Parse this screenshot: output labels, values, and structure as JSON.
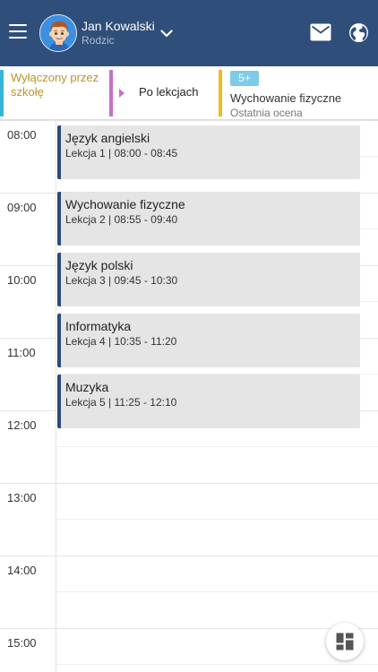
{
  "header": {
    "user_name": "Jan Kowalski",
    "user_role": "Rodzic",
    "menu_icon": "hamburger-menu-icon",
    "dropdown_icon": "chevron-down-icon",
    "mail_icon": "mail-icon",
    "globe_icon": "globe-icon",
    "background_color": "#2f4e79"
  },
  "info_strip": {
    "school_status": "Wyłączony przez szkołę",
    "after_lessons": "Po lekcjach",
    "grade": "5+",
    "grade_subject": "Wychowanie fizyczne",
    "grade_label": "Ostatnia ocena"
  },
  "timeline": {
    "hours": [
      "08:00",
      "09:00",
      "10:00",
      "11:00",
      "12:00",
      "13:00",
      "14:00",
      "15:00"
    ]
  },
  "lessons": [
    {
      "name": "Język angielski",
      "time": "Lekcja 1 | 08:00 - 08:45"
    },
    {
      "name": "Wychowanie fizyczne",
      "time": "Lekcja 2 | 08:55 - 09:40"
    },
    {
      "name": "Język polski",
      "time": "Lekcja 3 | 09:45 - 10:30"
    },
    {
      "name": "Informatyka",
      "time": "Lekcja 4 | 10:35 - 11:20"
    },
    {
      "name": "Muzyka",
      "time": "Lekcja 5 | 11:25 - 12:10"
    }
  ],
  "fab": {
    "icon": "dashboard-grid-icon"
  }
}
